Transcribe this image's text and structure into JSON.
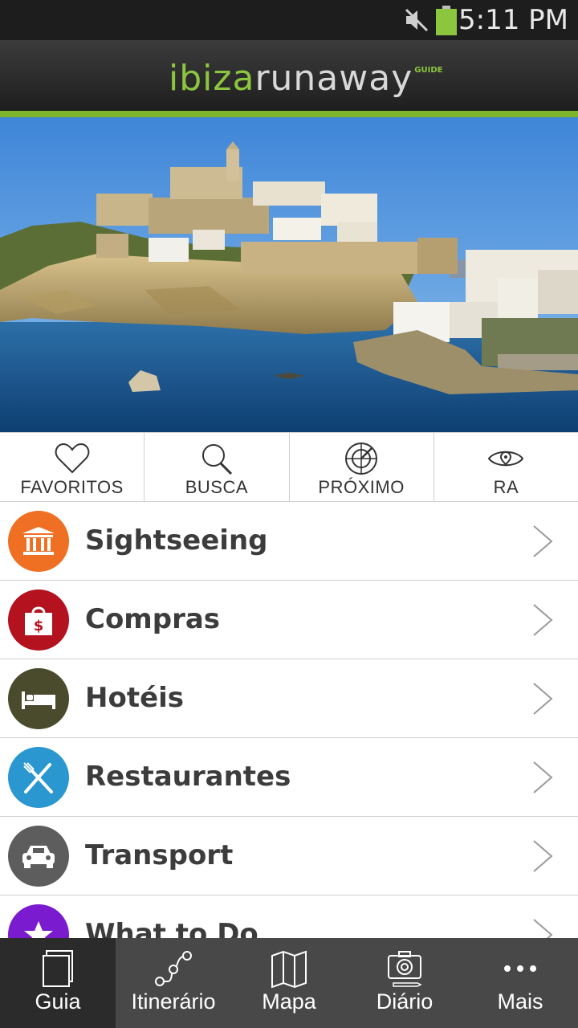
{
  "status_bar": {
    "time": "5:11 PM",
    "icons": [
      "mute-icon",
      "battery-icon"
    ],
    "battery_color": "#8cc63f"
  },
  "header": {
    "logo_part1": "ibiza",
    "logo_part2": "runaway",
    "logo_part3": "GUIDE",
    "accent_color": "#7fb52b"
  },
  "quick_actions": [
    {
      "label": "FAVORITOS",
      "icon": "heart-icon"
    },
    {
      "label": "BUSCA",
      "icon": "search-icon"
    },
    {
      "label": "PRÓXIMO",
      "icon": "radar-icon"
    },
    {
      "label": "RA",
      "icon": "eye-icon"
    }
  ],
  "categories": [
    {
      "label": "Sightseeing",
      "icon": "monument-icon",
      "color": "#ef6f23"
    },
    {
      "label": "Compras",
      "icon": "shopping-bag-icon",
      "color": "#b3121e"
    },
    {
      "label": "Hotéis",
      "icon": "bed-icon",
      "color": "#4a4a2c"
    },
    {
      "label": "Restaurantes",
      "icon": "fork-knife-icon",
      "color": "#2b97d0"
    },
    {
      "label": "Transport",
      "icon": "car-icon",
      "color": "#5d5d5d"
    },
    {
      "label": "What to Do",
      "icon": "star-icon",
      "color": "#7b1bd0"
    }
  ],
  "tabs": [
    {
      "label": "Guia",
      "icon": "book-icon",
      "active": true
    },
    {
      "label": "Itinerário",
      "icon": "route-icon",
      "active": false
    },
    {
      "label": "Mapa",
      "icon": "map-icon",
      "active": false
    },
    {
      "label": "Diário",
      "icon": "camera-icon",
      "active": false
    },
    {
      "label": "Mais",
      "icon": "more-icon",
      "active": false
    }
  ]
}
